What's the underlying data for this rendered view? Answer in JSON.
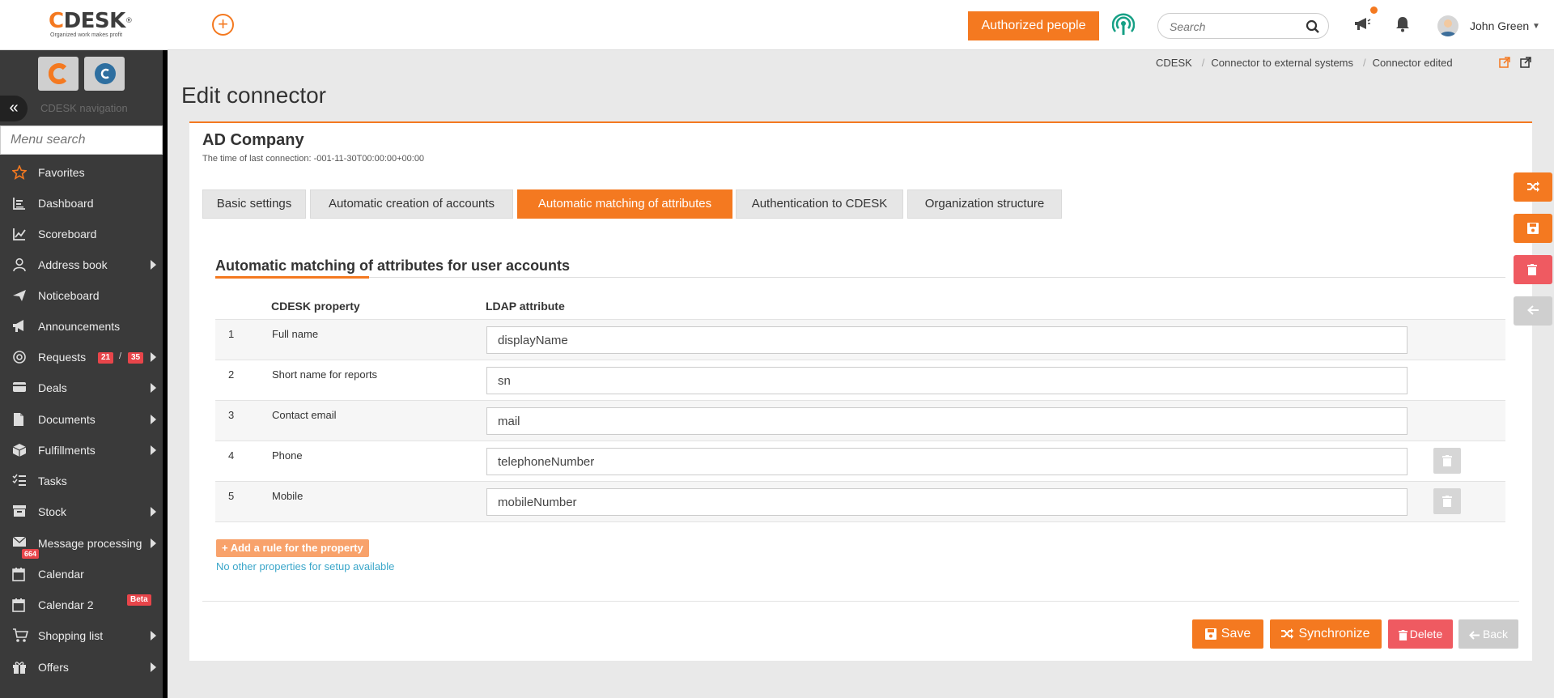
{
  "brand": {
    "name": "CDESK",
    "tagline": "Organized work makes profit",
    "accent": "#f47920"
  },
  "header": {
    "authorized_label": "Authorized people",
    "search_placeholder": "Search",
    "user_name": "John Green"
  },
  "sidebar": {
    "caption": "CDESK navigation",
    "search_placeholder": "Menu search",
    "items": [
      {
        "label": "Favorites",
        "icon": "star-icon"
      },
      {
        "label": "Dashboard",
        "icon": "dashboard-icon"
      },
      {
        "label": "Scoreboard",
        "icon": "chart-line-icon"
      },
      {
        "label": "Address book",
        "icon": "user-icon"
      },
      {
        "label": "Noticeboard",
        "icon": "paper-plane-icon"
      },
      {
        "label": "Announcements",
        "icon": "megaphone-icon"
      },
      {
        "label": "Requests",
        "icon": "requests-icon",
        "badge_a": "21",
        "badge_sep": "/",
        "badge_b": "35"
      },
      {
        "label": "Deals",
        "icon": "deals-icon"
      },
      {
        "label": "Documents",
        "icon": "document-icon"
      },
      {
        "label": "Fulfillments",
        "icon": "box-icon"
      },
      {
        "label": "Tasks",
        "icon": "tasks-icon"
      },
      {
        "label": "Stock",
        "icon": "stock-icon"
      },
      {
        "label": "Message processing",
        "icon": "envelope-icon",
        "badge": "664"
      },
      {
        "label": "Calendar",
        "icon": "calendar-icon"
      },
      {
        "label": "Calendar 2",
        "icon": "calendar-icon",
        "badge": "Beta"
      },
      {
        "label": "Shopping list",
        "icon": "cart-icon"
      },
      {
        "label": "Offers",
        "icon": "gift-icon"
      }
    ]
  },
  "breadcrumb": {
    "items": [
      "CDESK",
      "Connector to external systems",
      "Connector edited"
    ],
    "separator": "/"
  },
  "page": {
    "title": "Edit connector",
    "company": "AD Company",
    "last_connection": "The time of last connection: -001-11-30T00:00:00+00:00",
    "tabs": [
      "Basic settings",
      "Automatic creation of accounts",
      "Automatic matching of attributes",
      "Authentication to CDESK",
      "Organization structure"
    ],
    "active_tab": 2,
    "section_title": "Automatic matching of attributes for user accounts",
    "columns": {
      "property": "CDESK property",
      "attribute": "LDAP attribute"
    },
    "rows": [
      {
        "num": "1",
        "property": "Full name",
        "value": "displayName"
      },
      {
        "num": "2",
        "property": "Short name for reports",
        "value": "sn"
      },
      {
        "num": "3",
        "property": "Contact email",
        "value": "mail"
      },
      {
        "num": "4",
        "property": "Phone",
        "value": "telephoneNumber"
      },
      {
        "num": "5",
        "property": "Mobile",
        "value": "mobileNumber"
      }
    ],
    "add_rule_label": "+ Add a rule for the property",
    "no_props_text": "No other properties for setup available"
  },
  "footer": {
    "save": "Save",
    "synchronize": "Synchronize",
    "delete": "Delete",
    "back": "Back"
  }
}
